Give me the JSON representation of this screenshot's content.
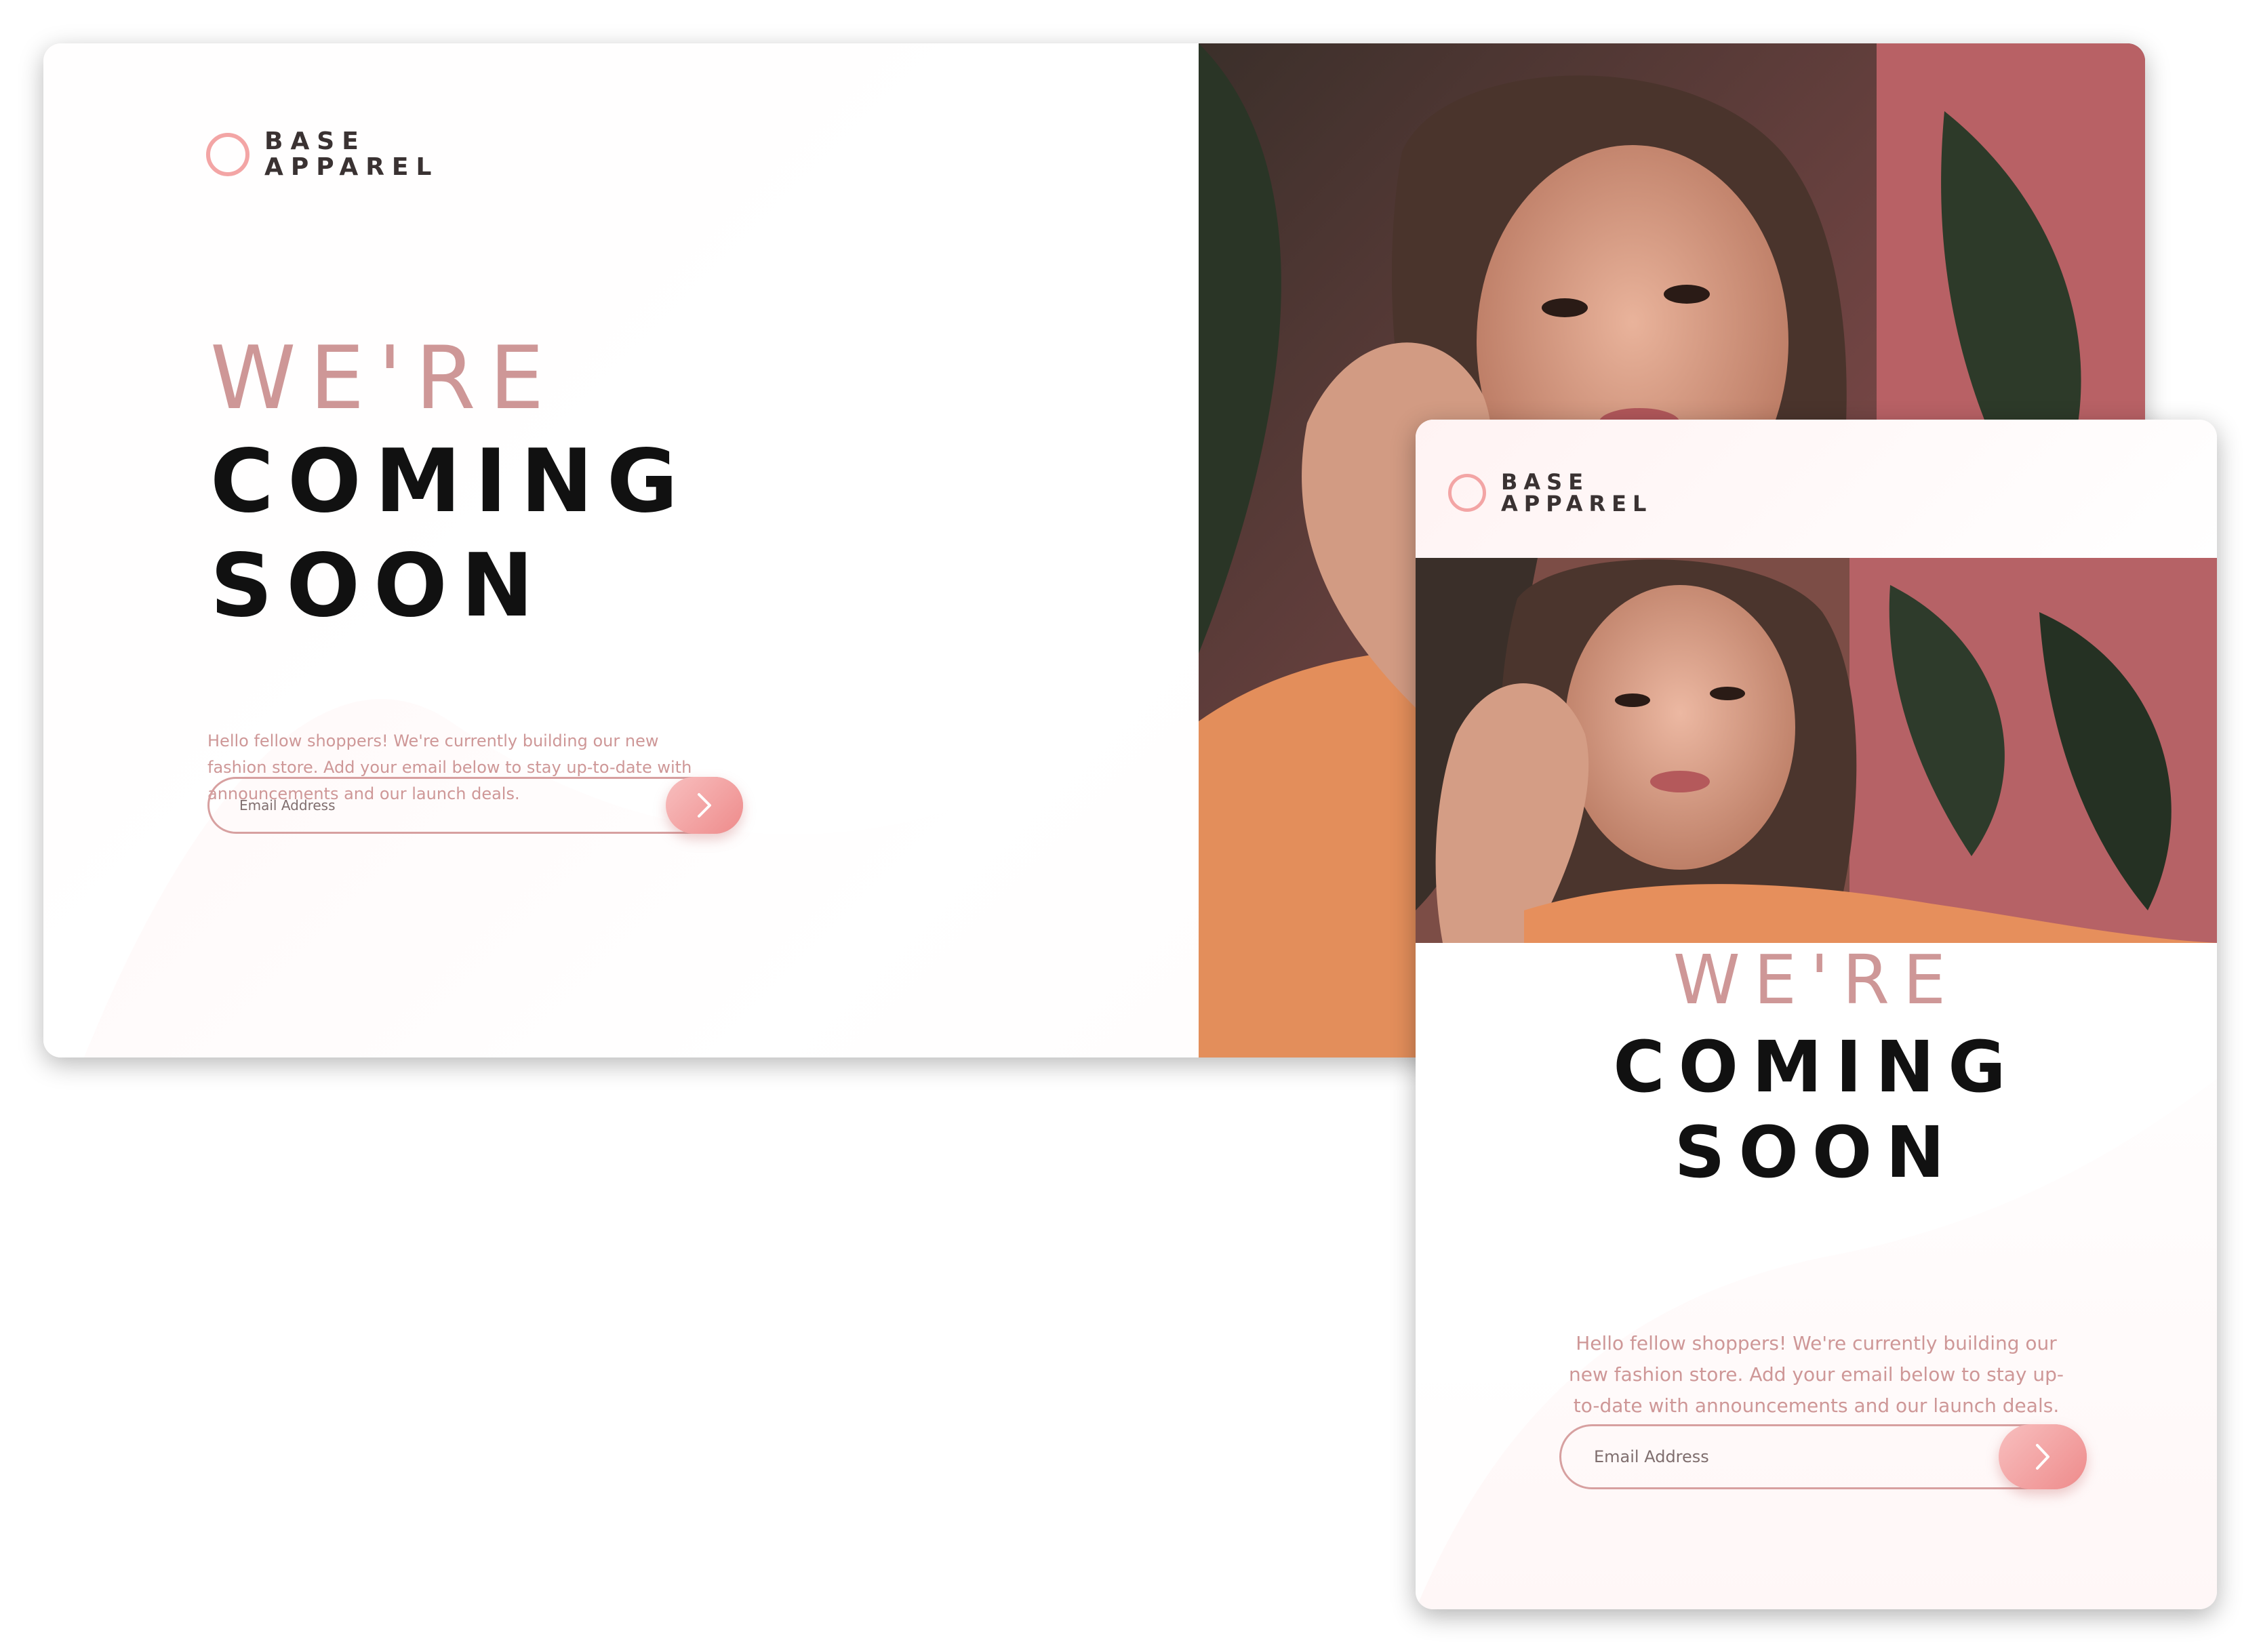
{
  "brand": {
    "name_line1": "BASE",
    "name_line2": "APPAREL",
    "accent_color": "#f3a5a5",
    "text_pink": "#ce9797",
    "dark_text": "#111111"
  },
  "hero": {
    "line1": "WE'RE",
    "line2": "COMING",
    "line3": "SOON"
  },
  "description": "Hello fellow shoppers! We're currently building our new fashion store. Add your email below to stay up-to-date with announcements and our launch deals.",
  "form": {
    "email_placeholder": "Email Address",
    "submit_icon": "chevron-right-icon"
  },
  "photo": {
    "alt": "Hero image"
  }
}
